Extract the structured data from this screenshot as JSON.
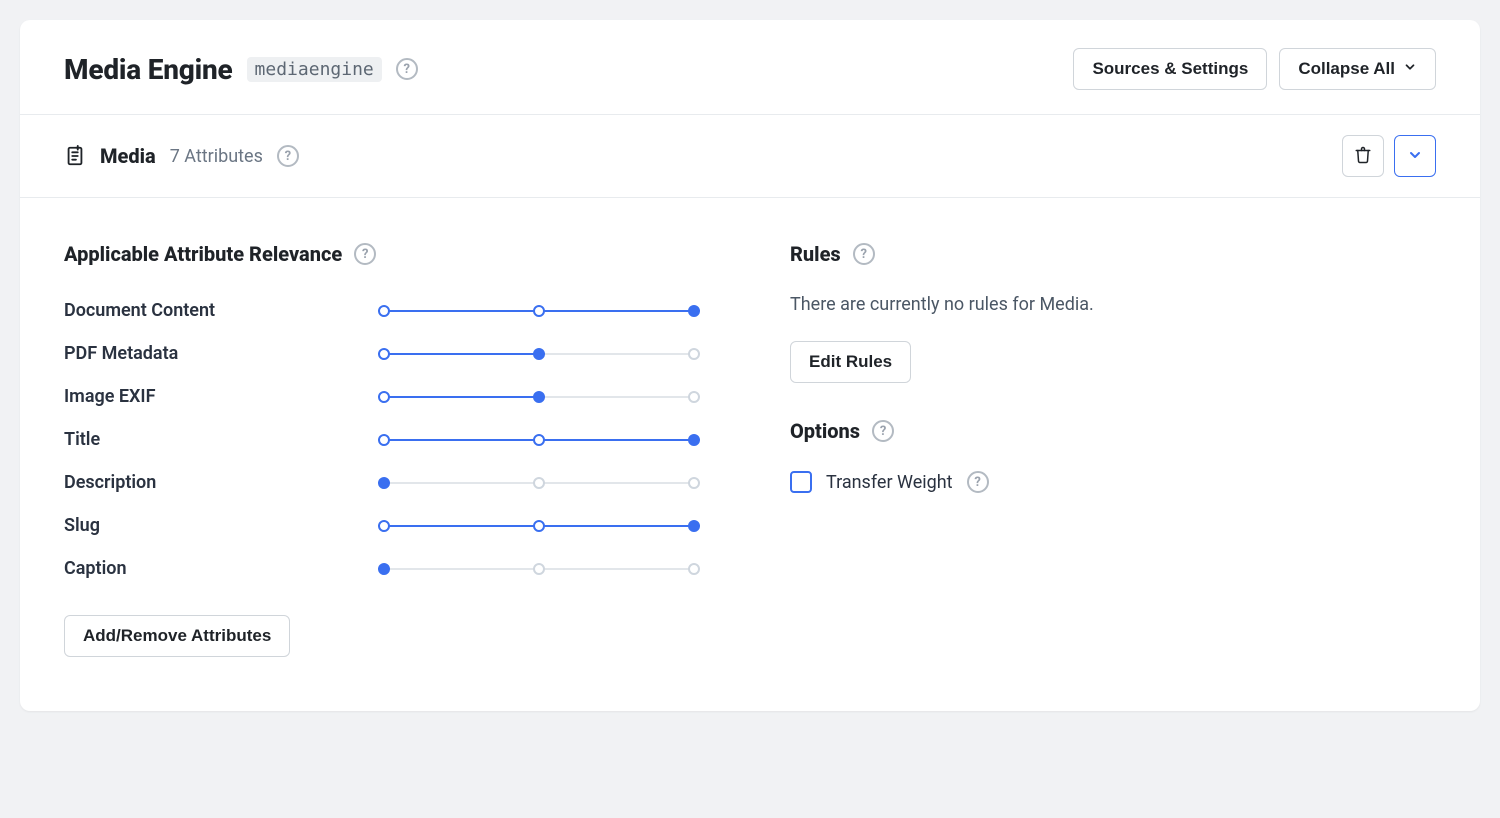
{
  "header": {
    "title": "Media Engine",
    "slug": "mediaengine",
    "sources_settings_label": "Sources & Settings",
    "collapse_all_label": "Collapse All"
  },
  "section": {
    "title": "Media",
    "attributes_count_label": "7 Attributes"
  },
  "relevance": {
    "heading": "Applicable Attribute Relevance",
    "attributes": [
      {
        "label": "Document Content",
        "value": 2
      },
      {
        "label": "PDF Metadata",
        "value": 1
      },
      {
        "label": "Image EXIF",
        "value": 1
      },
      {
        "label": "Title",
        "value": 2
      },
      {
        "label": "Description",
        "value": 0
      },
      {
        "label": "Slug",
        "value": 2
      },
      {
        "label": "Caption",
        "value": 0
      }
    ],
    "add_remove_label": "Add/Remove Attributes"
  },
  "rules": {
    "heading": "Rules",
    "empty_text": "There are currently no rules for Media.",
    "edit_label": "Edit Rules"
  },
  "options": {
    "heading": "Options",
    "transfer_weight_label": "Transfer Weight",
    "transfer_weight_checked": false
  }
}
